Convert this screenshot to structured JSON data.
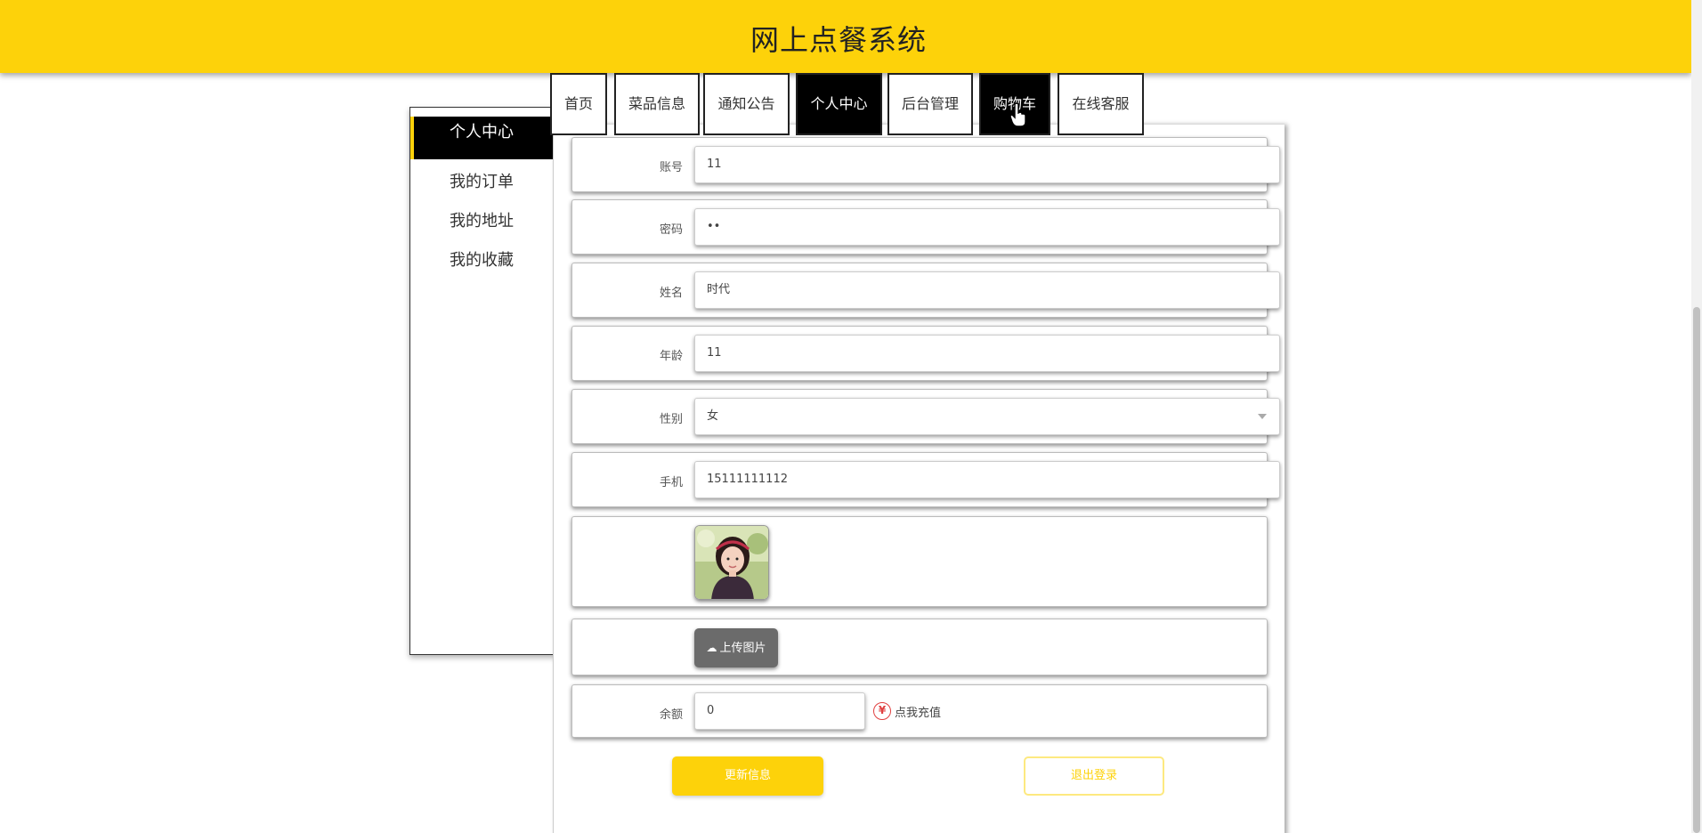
{
  "header": {
    "title": "网上点餐系统"
  },
  "nav": [
    {
      "label": "首页",
      "active": false
    },
    {
      "label": "菜品信息",
      "active": false
    },
    {
      "label": "通知公告",
      "active": false
    },
    {
      "label": "个人中心",
      "active": true
    },
    {
      "label": "后台管理",
      "active": false
    },
    {
      "label": "购物车",
      "active": true
    },
    {
      "label": "在线客服",
      "active": false
    }
  ],
  "sidebar": {
    "items": [
      {
        "label": "个人中心",
        "active": true
      },
      {
        "label": "我的订单"
      },
      {
        "label": "我的地址"
      },
      {
        "label": "我的收藏"
      }
    ]
  },
  "form": {
    "account": {
      "label": "账号",
      "value": "11"
    },
    "password": {
      "label": "密码",
      "value": "••"
    },
    "name": {
      "label": "姓名",
      "value": "时代"
    },
    "age": {
      "label": "年龄",
      "value": "11"
    },
    "gender": {
      "label": "性别",
      "value": "女"
    },
    "phone": {
      "label": "手机",
      "value": "15111111112"
    },
    "upload_label": "上传图片",
    "balance": {
      "label": "余额",
      "value": "0"
    },
    "recharge_label": "点我充值",
    "update_label": "更新信息",
    "logout_label": "退出登录"
  },
  "colors": {
    "accent": "#fdd20a",
    "nav_active": "#000000"
  },
  "icons": {
    "upload": "cloud-upload-icon",
    "yen": "yen-icon",
    "caret": "chevron-down-icon"
  }
}
